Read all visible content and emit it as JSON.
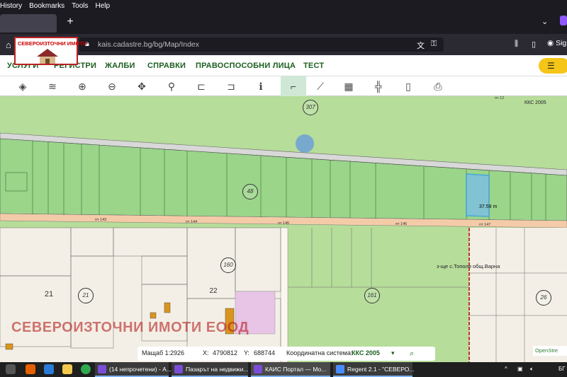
{
  "browser": {
    "menu": [
      "History",
      "Bookmarks",
      "Tools",
      "Help"
    ],
    "url": "kais.cadastre.bg/bg/Map/Index",
    "account_label": "Sig",
    "new_tab": "+",
    "colors": {
      "chrome": "#1c1b22",
      "toolbar": "#2b2a33",
      "accent": "#9059ff"
    }
  },
  "logo_overlay": {
    "text": "СЕВЕРОИЗТОЧНИ ИМОТИ"
  },
  "site_nav": {
    "items": [
      "УСЛУГИ",
      "РЕГИСТРИ",
      "ЖАЛБИ",
      "СПРАВКИ",
      "ПРАВОСПОСОБНИ ЛИЦА",
      "ТЕСТ"
    ],
    "user_icon": "menu-icon",
    "colors": {
      "nav_text": "#1b5e20",
      "user_button": "#f5c518"
    }
  },
  "tools": [
    {
      "name": "layers-base-icon",
      "glyph": "◈"
    },
    {
      "name": "layers-icon",
      "glyph": "≋"
    },
    {
      "name": "zoom-in-icon",
      "glyph": "⊕"
    },
    {
      "name": "zoom-out-icon",
      "glyph": "⊖"
    },
    {
      "name": "pan-icon",
      "glyph": "✥"
    },
    {
      "name": "location-pin-icon",
      "glyph": "⚲"
    },
    {
      "name": "select-add-icon",
      "glyph": "⊏"
    },
    {
      "name": "select-remove-icon",
      "glyph": "⊐"
    },
    {
      "name": "info-icon",
      "glyph": "ℹ"
    },
    {
      "name": "measure-distance-icon",
      "glyph": "⌐"
    },
    {
      "name": "measure-area-icon",
      "glyph": "⟋"
    },
    {
      "name": "map-icon",
      "glyph": "▦"
    },
    {
      "name": "crosshair-icon",
      "glyph": "╬"
    },
    {
      "name": "document-icon",
      "glyph": "▯"
    },
    {
      "name": "print-icon",
      "glyph": "⎙"
    }
  ],
  "map": {
    "crs_label": "ККС 2005",
    "plot_badges": [
      "307",
      "48",
      "160",
      "21",
      "22",
      "161",
      "26"
    ],
    "measurement": "37.59 m",
    "village_label": "з-ще с.Тополи общ.Варна",
    "watermark": "СЕВЕРОИЗТОЧНИ ИМОТИ ЕООД",
    "big_numbers": [
      "21",
      "22"
    ],
    "road_labels": [
      "пт 143",
      "пт 144",
      "пт 145",
      "пт 146",
      "пт 147",
      "пт 12"
    ],
    "colors": {
      "field": "#b6dd9a",
      "plot_fill": "#9ad58a",
      "built": "#f3efe6",
      "selected": "#3aa0e6",
      "boundary_red": "#c0392b"
    }
  },
  "status": {
    "scale_label": "Мащаб 1:",
    "scale_value": "2926",
    "x_label": "X:",
    "x_value": "4790812",
    "y_label": "Y:",
    "y_value": "688744",
    "crs_label": "Координатна система:",
    "crs_value": "ККС 2005",
    "osm": "OpenStre"
  },
  "taskbar": {
    "items": [
      "(14 непрочетени) - А...",
      "Пазарът на недвижи...",
      "КАИС Портал — Мо...",
      "Regent 2.1 - \"СЕВЕРО..."
    ],
    "lang": "БГ"
  }
}
